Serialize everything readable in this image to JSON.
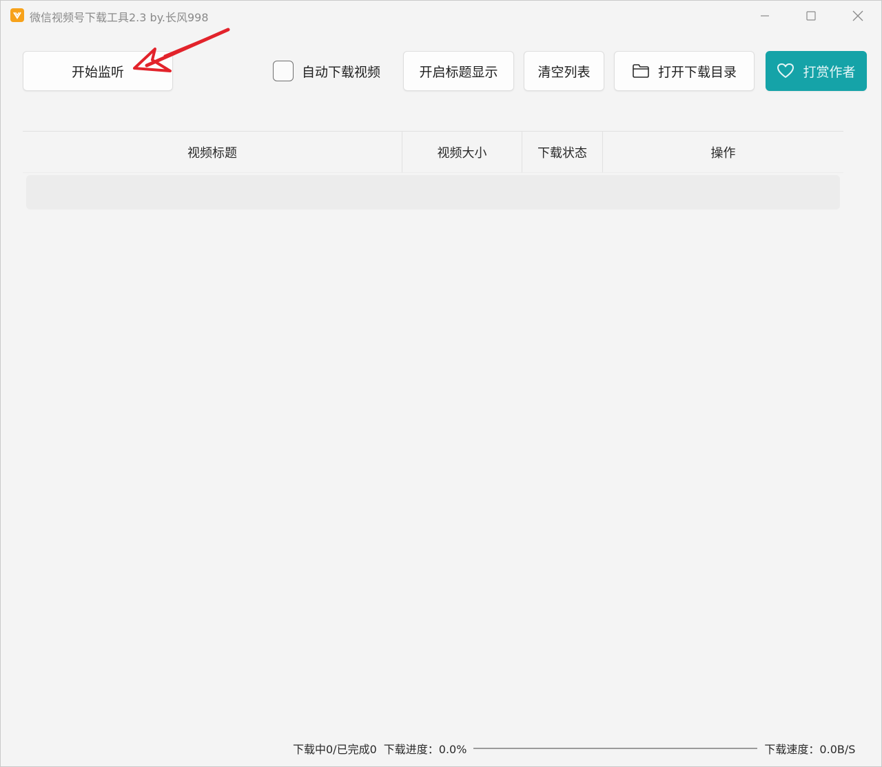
{
  "window": {
    "title": "微信视频号下载工具2.3 by.长风998",
    "icon": "app-logo-icon",
    "accent": "#15a3a8",
    "icon_color": "#f7a21b"
  },
  "toolbar": {
    "start_label": "开始监听",
    "auto_download_label": "自动下载视频",
    "auto_download_checked": false,
    "show_title_label": "开启标题显示",
    "clear_label": "清空列表",
    "open_dir_label": "打开下载目录",
    "donate_label": "打赏作者"
  },
  "table": {
    "columns": [
      "视频标题",
      "视频大小",
      "下载状态",
      "操作"
    ],
    "rows": []
  },
  "status": {
    "counts": "下载中0/已完成0",
    "progress_label": "下载进度：0.0%",
    "progress": 0.0,
    "speed": "下载速度：0.0B/S"
  }
}
